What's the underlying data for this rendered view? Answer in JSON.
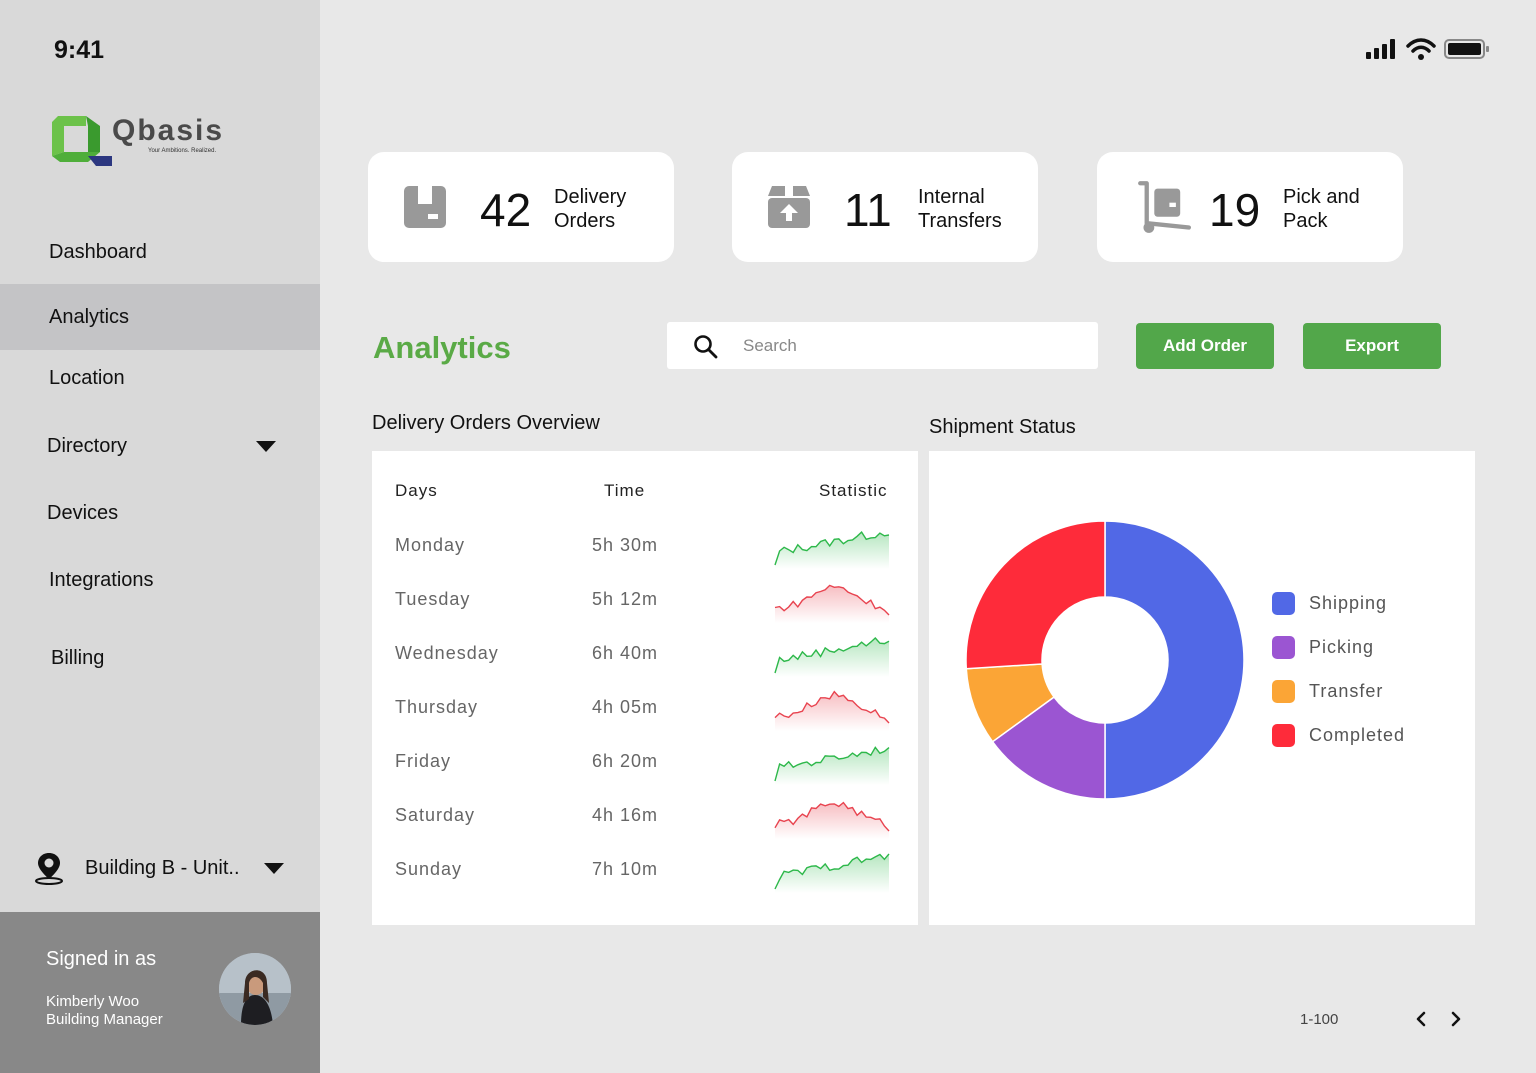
{
  "clock": "9:41",
  "brand": {
    "name": "Qbasis",
    "tagline": "Your Ambitions. Realized."
  },
  "sidebar": {
    "items": [
      {
        "label": "Dashboard"
      },
      {
        "label": "Analytics"
      },
      {
        "label": "Location"
      },
      {
        "label": "Directory"
      },
      {
        "label": "Devices"
      },
      {
        "label": "Integrations"
      },
      {
        "label": "Billing"
      }
    ],
    "active": "Analytics",
    "building": "Building B - Unit..",
    "signed_in_label": "Signed in as",
    "user_name": "Kimberly Woo",
    "user_role": "Building Manager"
  },
  "cards": [
    {
      "value": "42",
      "line1": "Delivery",
      "line2": "Orders",
      "icon": "box-icon"
    },
    {
      "value": "11",
      "line1": "Internal",
      "line2": "Transfers",
      "icon": "upload-box-icon"
    },
    {
      "value": "19",
      "line1": "Pick and",
      "line2": "Pack",
      "icon": "hand-truck-icon"
    }
  ],
  "main": {
    "title": "Analytics",
    "search_placeholder": "Search",
    "add_order_label": "Add Order",
    "export_label": "Export"
  },
  "table": {
    "title": "Delivery Orders Overview",
    "headers": [
      "Days",
      "Time",
      "Statistic"
    ],
    "rows": [
      {
        "day": "Monday",
        "time": "5h 30m",
        "trend": "up"
      },
      {
        "day": "Tuesday",
        "time": "5h 12m",
        "trend": "down"
      },
      {
        "day": "Wednesday",
        "time": "6h 40m",
        "trend": "up"
      },
      {
        "day": "Thursday",
        "time": "4h 05m",
        "trend": "down"
      },
      {
        "day": "Friday",
        "time": "6h 20m",
        "trend": "up"
      },
      {
        "day": "Saturday",
        "time": "4h 16m",
        "trend": "down"
      },
      {
        "day": "Sunday",
        "time": "7h 10m",
        "trend": "up"
      }
    ]
  },
  "chart_data": {
    "type": "pie",
    "title": "Shipment Status",
    "donut": true,
    "legend_position": "right",
    "categories": [
      "Shipping",
      "Picking",
      "Transfer",
      "Completed"
    ],
    "values": [
      50,
      15,
      9,
      26
    ],
    "colors": [
      "#5168e6",
      "#9b55d2",
      "#fba536",
      "#fe2b3a"
    ]
  },
  "colors": {
    "accent": "#52a74a",
    "title_green": "#5aaa46",
    "up": "#2db84a",
    "down": "#e8434f"
  },
  "pagination": {
    "range": "1-100"
  }
}
